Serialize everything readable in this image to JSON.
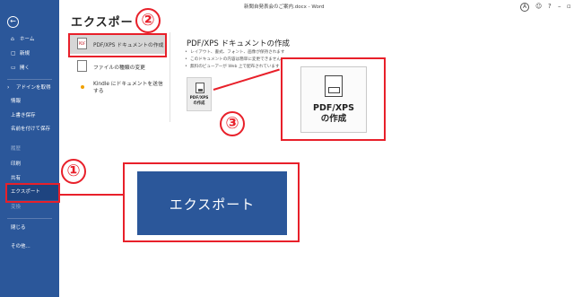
{
  "app": {
    "doc_title": "新聞自発表会のご案内.docx  -  Word"
  },
  "titlebar": {
    "avatar": "A",
    "help": "?",
    "minimize": "–",
    "restore": "▫",
    "close": "✕",
    "feedback": "☺"
  },
  "sidebar": {
    "back": "←",
    "home": "ホーム",
    "new": "新規",
    "open": "開く",
    "info": "アドインを取得",
    "info2": "情報",
    "save": "上書き保存",
    "save_as": "名前を付けて保存",
    "history": "履歴",
    "print": "印刷",
    "share": "共有",
    "export": "エクスポート",
    "transform": "変換",
    "close": "閉じる",
    "more": "その他..."
  },
  "page": {
    "title": "エクスポート",
    "options": [
      {
        "label": "PDF/XPS ドキュメントの作成",
        "icon": "PDF"
      },
      {
        "label": "ファイルの種類の変更"
      },
      {
        "label": "Kindle にドキュメントを送信する"
      }
    ],
    "pdf_heading": "PDF/XPS ドキュメントの作成",
    "bullets": [
      "レイアウト、書式、フォント、画像が保持されます",
      "このドキュメントの内容は簡単に変更できません",
      "無料のビューアーが Web 上で配布されています"
    ],
    "create_button_line1": "PDF/XPS",
    "create_button_line2": "の作成"
  },
  "callouts": {
    "pdf_line1": "PDF/XPS",
    "pdf_line2": "の作成",
    "export_label": "エクスポート"
  },
  "steps": [
    "①",
    "②",
    "③"
  ],
  "colors": {
    "accent_red": "#e8202a",
    "word_blue": "#2b579a"
  }
}
